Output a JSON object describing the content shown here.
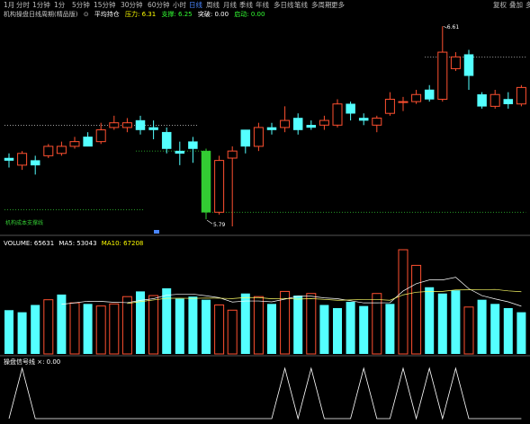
{
  "toolbar": {
    "items": [
      "1月",
      "分时",
      "1分钟",
      "1分",
      "5分钟",
      "15分钟",
      "30分钟",
      "60分钟",
      "小时",
      "日线",
      "周线",
      "月线",
      "季线",
      "年线",
      "多日线",
      "笔线",
      "多周期",
      "更多"
    ],
    "active_index": 9,
    "right_items": [
      "复权",
      "叠加",
      "多"
    ]
  },
  "main_panel": {
    "indicator_name": "机构操盘日线周期(精品版)",
    "badge": "⊙",
    "label_1": "平均持仓",
    "label_2": "压力: 6.31",
    "label_3": "支撑: 6.25",
    "label_4": "突破: 0.00",
    "label_5": "启动: 0.00",
    "high_marker": "6.61",
    "low_marker": "5.79",
    "left_bottom_label": "机构成本支撑线"
  },
  "volume_panel": {
    "title": "VOLUME: 65631",
    "ma5": "MA5: 53043",
    "ma10": "MA10: 67208"
  },
  "signal_panel": {
    "title": "操盘信号线 ×: 0.00"
  },
  "chart_data": [
    {
      "type": "candlestick",
      "candles": [
        {
          "o": 6.04,
          "c": 6.05,
          "h": 6.07,
          "l": 6.01,
          "up": false
        },
        {
          "o": 6.02,
          "c": 6.07,
          "h": 6.08,
          "l": 6.0,
          "up": true
        },
        {
          "o": 6.04,
          "c": 6.02,
          "h": 6.06,
          "l": 5.98,
          "up": false
        },
        {
          "o": 6.06,
          "c": 6.1,
          "h": 6.11,
          "l": 6.05,
          "up": true
        },
        {
          "o": 6.07,
          "c": 6.1,
          "h": 6.12,
          "l": 6.06,
          "up": true
        },
        {
          "o": 6.1,
          "c": 6.12,
          "h": 6.14,
          "l": 6.09,
          "up": true
        },
        {
          "o": 6.14,
          "c": 6.1,
          "h": 6.16,
          "l": 6.1,
          "up": false
        },
        {
          "o": 6.12,
          "c": 6.17,
          "h": 6.2,
          "l": 6.11,
          "up": true
        },
        {
          "o": 6.18,
          "c": 6.2,
          "h": 6.23,
          "l": 6.17,
          "up": true
        },
        {
          "o": 6.2,
          "c": 6.18,
          "h": 6.22,
          "l": 6.16,
          "up": true
        },
        {
          "o": 6.21,
          "c": 6.17,
          "h": 6.23,
          "l": 6.15,
          "up": false
        },
        {
          "o": 6.18,
          "c": 6.17,
          "h": 6.21,
          "l": 6.13,
          "up": false
        },
        {
          "o": 6.16,
          "c": 6.09,
          "h": 6.18,
          "l": 6.07,
          "up": false
        },
        {
          "o": 6.08,
          "c": 6.07,
          "h": 6.12,
          "l": 6.02,
          "up": false
        },
        {
          "o": 6.12,
          "c": 6.09,
          "h": 6.14,
          "l": 6.03,
          "up": false
        },
        {
          "o": 6.08,
          "c": 5.82,
          "h": 6.09,
          "l": 5.79,
          "up": false,
          "green": true
        },
        {
          "o": 5.82,
          "c": 6.04,
          "h": 6.06,
          "l": 5.81,
          "up": true
        },
        {
          "o": 6.05,
          "c": 6.08,
          "h": 6.1,
          "l": 5.76,
          "up": true
        },
        {
          "o": 6.1,
          "c": 6.17,
          "h": 6.17,
          "l": 6.07,
          "up": false
        },
        {
          "o": 6.1,
          "c": 6.18,
          "h": 6.2,
          "l": 6.08,
          "up": true
        },
        {
          "o": 6.18,
          "c": 6.17,
          "h": 6.2,
          "l": 6.15,
          "up": false
        },
        {
          "o": 6.18,
          "c": 6.21,
          "h": 6.27,
          "l": 6.16,
          "up": true
        },
        {
          "o": 6.22,
          "c": 6.17,
          "h": 6.24,
          "l": 6.15,
          "up": false
        },
        {
          "o": 6.19,
          "c": 6.18,
          "h": 6.21,
          "l": 6.17,
          "up": false
        },
        {
          "o": 6.19,
          "c": 6.21,
          "h": 6.23,
          "l": 6.17,
          "up": true
        },
        {
          "o": 6.19,
          "c": 6.28,
          "h": 6.3,
          "l": 6.18,
          "up": true
        },
        {
          "o": 6.28,
          "c": 6.24,
          "h": 6.29,
          "l": 6.21,
          "up": false
        },
        {
          "o": 6.22,
          "c": 6.21,
          "h": 6.24,
          "l": 6.19,
          "up": false
        },
        {
          "o": 6.19,
          "c": 6.22,
          "h": 6.23,
          "l": 6.16,
          "up": true
        },
        {
          "o": 6.24,
          "c": 6.3,
          "h": 6.33,
          "l": 6.23,
          "up": true
        },
        {
          "o": 6.29,
          "c": 6.29,
          "h": 6.31,
          "l": 6.25,
          "up": true
        },
        {
          "o": 6.29,
          "c": 6.32,
          "h": 6.34,
          "l": 6.28,
          "up": true
        },
        {
          "o": 6.34,
          "c": 6.3,
          "h": 6.36,
          "l": 6.29,
          "up": false
        },
        {
          "o": 6.3,
          "c": 6.5,
          "h": 6.61,
          "l": 6.29,
          "up": true
        },
        {
          "o": 6.43,
          "c": 6.48,
          "h": 6.5,
          "l": 6.42,
          "up": true
        },
        {
          "o": 6.49,
          "c": 6.4,
          "h": 6.51,
          "l": 6.34,
          "up": false
        },
        {
          "o": 6.32,
          "c": 6.27,
          "h": 6.33,
          "l": 6.26,
          "up": false
        },
        {
          "o": 6.27,
          "c": 6.32,
          "h": 6.34,
          "l": 6.26,
          "up": true
        },
        {
          "o": 6.3,
          "c": 6.28,
          "h": 6.33,
          "l": 6.26,
          "up": false
        },
        {
          "o": 6.28,
          "c": 6.35,
          "h": 6.36,
          "l": 6.27,
          "up": true
        }
      ],
      "ylim": [
        5.76,
        6.63
      ],
      "resistance_levels": [
        6.48,
        6.19,
        6.08,
        5.83,
        5.82
      ]
    },
    {
      "type": "bar",
      "values": [
        42,
        40,
        47,
        52,
        57,
        49,
        48,
        46,
        48,
        55,
        60,
        56,
        63,
        53,
        55,
        52,
        47,
        42,
        58,
        55,
        48,
        60,
        56,
        58,
        47,
        44,
        50,
        46,
        58,
        48,
        100,
        85,
        64,
        58,
        61,
        45,
        52,
        48,
        44,
        40
      ],
      "up": [
        false,
        false,
        false,
        true,
        false,
        true,
        false,
        true,
        true,
        true,
        false,
        true,
        false,
        false,
        false,
        false,
        true,
        true,
        false,
        true,
        false,
        true,
        false,
        true,
        false,
        false,
        false,
        false,
        true,
        false,
        true,
        true,
        false,
        false,
        false,
        true,
        false,
        false,
        false,
        false
      ],
      "ylim": [
        0,
        100
      ]
    },
    {
      "type": "line",
      "values": [
        0,
        1,
        0,
        0,
        0,
        0,
        0,
        0,
        0,
        0,
        0,
        0,
        0,
        0,
        0,
        0,
        0,
        0,
        0,
        0,
        0,
        1,
        0,
        1,
        0,
        0,
        0,
        1,
        0,
        0,
        1,
        0,
        1,
        0,
        1,
        0,
        0,
        0,
        0,
        0
      ],
      "ylim": [
        0,
        1
      ]
    }
  ]
}
